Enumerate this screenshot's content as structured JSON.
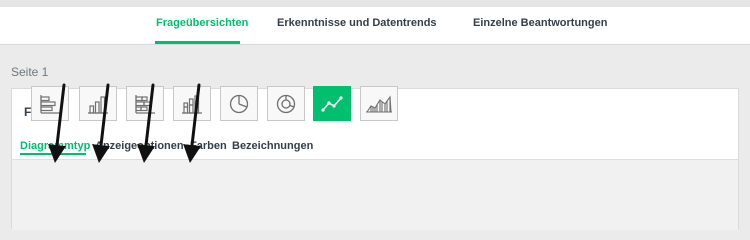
{
  "topnav": {
    "tabs": [
      {
        "label": "Frageübersichten",
        "active": true
      },
      {
        "label": "Erkenntnisse und Datentrends",
        "active": false
      },
      {
        "label": "Einzelne Beantwortungen",
        "active": false
      }
    ]
  },
  "page": {
    "label": "Seite 1"
  },
  "question": {
    "title": "F1",
    "subtabs": [
      {
        "label": "Diagrammtyp",
        "active": true
      },
      {
        "label": "Anzeigeoptionen",
        "active": false
      },
      {
        "label": "Farben",
        "active": false
      },
      {
        "label": "Bezeichnungen",
        "active": false
      }
    ]
  },
  "chart_types": [
    {
      "icon": "horizontal-bar-chart-icon",
      "selected": false
    },
    {
      "icon": "vertical-bar-chart-icon",
      "selected": false
    },
    {
      "icon": "stacked-horizontal-bar-chart-icon",
      "selected": false
    },
    {
      "icon": "stacked-vertical-bar-chart-icon",
      "selected": false
    },
    {
      "icon": "pie-chart-icon",
      "selected": false
    },
    {
      "icon": "donut-chart-icon",
      "selected": false
    },
    {
      "icon": "line-chart-icon",
      "selected": true
    },
    {
      "icon": "area-chart-icon",
      "selected": false
    }
  ],
  "colors": {
    "accent": "#00bf6f",
    "annotation_arrow": "#111111"
  }
}
